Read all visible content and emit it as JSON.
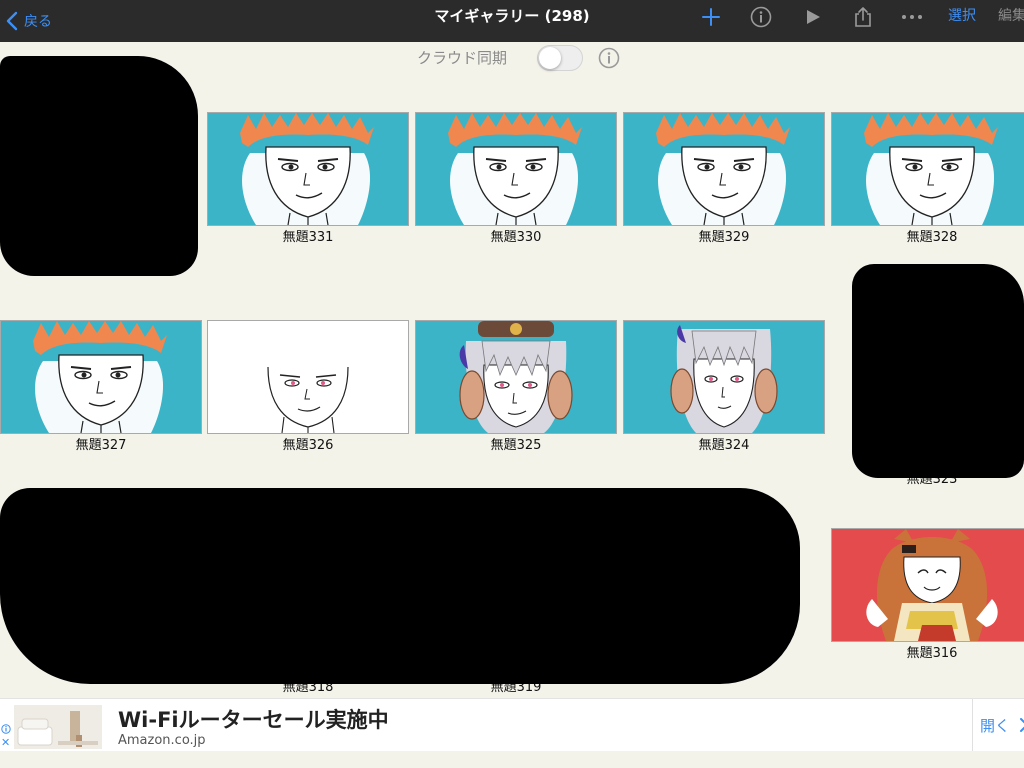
{
  "navbar": {
    "back_label": "戻る",
    "title": "マイギャラリー (298)",
    "icons": [
      "plus-icon",
      "info-icon",
      "play-icon",
      "share-icon",
      "more-icon"
    ],
    "select_label": "選択",
    "edit_label": "編集"
  },
  "cloud_sync": {
    "label": "クラウド同期",
    "enabled": false
  },
  "gallery": [
    {
      "title": "無題331"
    },
    {
      "title": "無題330"
    },
    {
      "title": "無題329"
    },
    {
      "title": "無題328"
    },
    {
      "title": "無題327"
    },
    {
      "title": "無題326"
    },
    {
      "title": "無題325"
    },
    {
      "title": "無題324"
    },
    {
      "title": "無題323"
    },
    {
      "title": "無題318"
    },
    {
      "title": "無題319"
    },
    {
      "title": "無題316"
    }
  ],
  "ad": {
    "title": "Wi-Fiルーターセール実施中",
    "domain": "Amazon.co.jp",
    "open_label": "開く",
    "close_symbol": "✕"
  },
  "colors": {
    "accent": "#3d8ff5",
    "navbar_bg": "#2b2b2b",
    "page_bg": "#f4f3ea",
    "thumb_cyan": "#3bb4c8",
    "thumb_red": "#e44b4c",
    "hair_orange": "#f0874f"
  }
}
